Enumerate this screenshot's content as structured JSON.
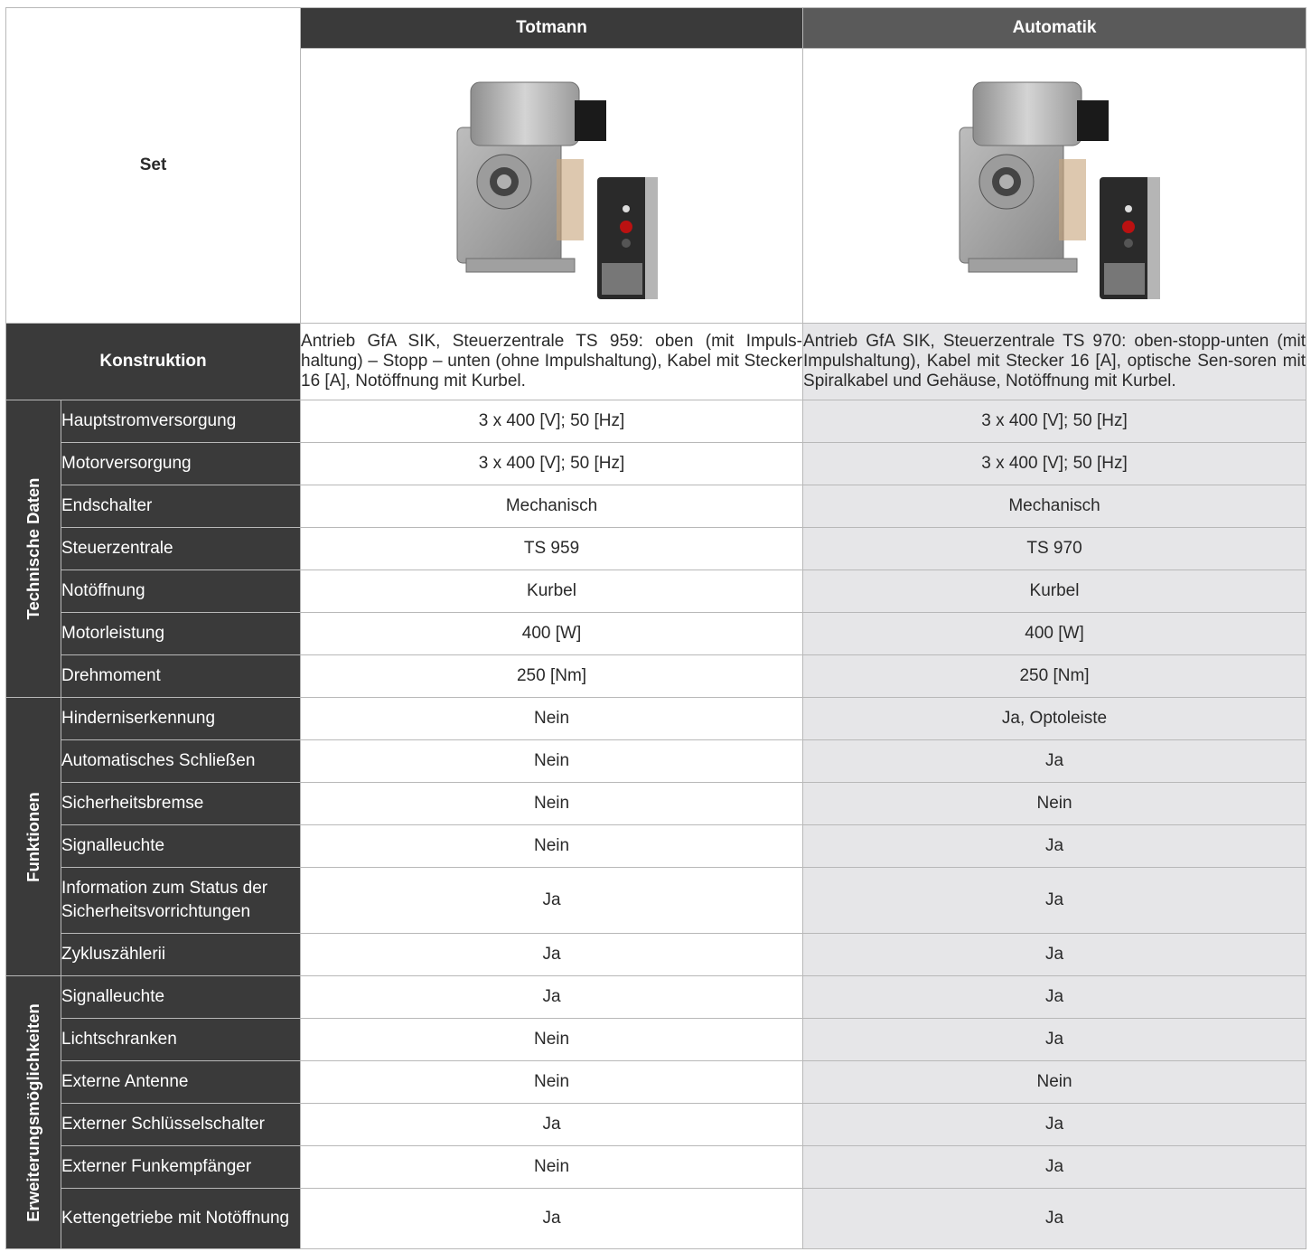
{
  "header": {
    "col1": "Totmann",
    "col2": "Automatik"
  },
  "set_label": "Set",
  "konstruktion": {
    "label": "Konstruktion",
    "col1": "Antrieb GfA SIK, Steuerzentrale TS 959: oben (mit Impuls-haltung) – Stopp – unten (ohne Impulshaltung), Kabel mit Stecker 16 [A], Notöffnung mit Kurbel.",
    "col2": "Antrieb GfA SIK, Steuerzentrale TS 970: oben-stopp-unten (mit Impulshaltung), Kabel mit Stecker 16 [A], optische Sen-soren mit Spiralkabel und Gehäuse, Notöffnung mit Kurbel."
  },
  "groups": {
    "technische": "Technische Daten",
    "funktionen": "Funktionen",
    "erweiterung": "Erweiterungsmöglichkeiten"
  },
  "rows": [
    {
      "label": "Hauptstromversorgung",
      "v1": "3 x 400 [V]; 50 [Hz]",
      "v2": "3 x 400 [V]; 50 [Hz]"
    },
    {
      "label": "Motorversorgung",
      "v1": "3 x 400 [V]; 50 [Hz]",
      "v2": "3 x 400 [V]; 50 [Hz]"
    },
    {
      "label": "Endschalter",
      "v1": "Mechanisch",
      "v2": "Mechanisch"
    },
    {
      "label": "Steuerzentrale",
      "v1": "TS 959",
      "v2": "TS 970"
    },
    {
      "label": "Notöffnung",
      "v1": "Kurbel",
      "v2": "Kurbel"
    },
    {
      "label": "Motorleistung",
      "v1": "400 [W]",
      "v2": "400 [W]"
    },
    {
      "label": "Drehmoment",
      "v1": "250 [Nm]",
      "v2": "250 [Nm]"
    },
    {
      "label": "Hinderniserkennung",
      "v1": "Nein",
      "v2": "Ja, Optoleiste"
    },
    {
      "label": "Automatisches Schließen",
      "v1": "Nein",
      "v2": "Ja"
    },
    {
      "label": "Sicherheitsbremse",
      "v1": "Nein",
      "v2": "Nein"
    },
    {
      "label": "Signalleuchte",
      "v1": "Nein",
      "v2": "Ja"
    },
    {
      "label": "Information zum Status der Sicherheitsvorrichtungen",
      "v1": "Ja",
      "v2": "Ja"
    },
    {
      "label": "Zykluszählerii",
      "v1": "Ja",
      "v2": "Ja"
    },
    {
      "label": "Signalleuchte",
      "v1": "Ja",
      "v2": "Ja"
    },
    {
      "label": "Lichtschranken",
      "v1": "Nein",
      "v2": "Ja"
    },
    {
      "label": "Externe Antenne",
      "v1": "Nein",
      "v2": "Nein"
    },
    {
      "label": "Externer Schlüsselschalter",
      "v1": "Ja",
      "v2": "Ja"
    },
    {
      "label": "Externer Funkempfänger",
      "v1": "Nein",
      "v2": "Ja"
    },
    {
      "label": "Kettengetriebe mit Notöffnung",
      "v1": "Ja",
      "v2": "Ja"
    }
  ],
  "images": {
    "col1": "motor-drive-with-control-unit",
    "col2": "motor-drive-with-control-unit"
  },
  "colors": {
    "header_dark": "#3a3a3a",
    "header_mid": "#5a5a5a",
    "shade": "#e6e6e8"
  }
}
